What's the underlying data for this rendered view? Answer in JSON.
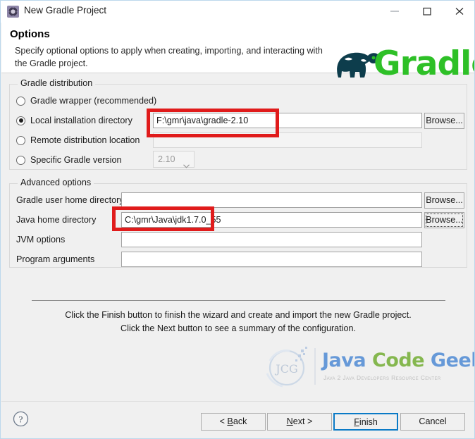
{
  "window": {
    "title": "New Gradle Project",
    "icon": "gradle-app-icon",
    "controls": {
      "minimize": "minimize-icon",
      "maximize": "maximize-icon",
      "close": "close-icon"
    }
  },
  "header": {
    "title": "Options",
    "description": "Specify optional options to apply when creating, importing, and interacting with the Gradle project.",
    "logo_text": "Gradle",
    "logo_icon": "gradle-elephant-icon",
    "logo_color": "#2ec027",
    "logo_elephant_color": "#0d3d4c"
  },
  "gradle_distribution": {
    "group_title": "Gradle distribution",
    "options": [
      {
        "label": "Gradle wrapper (recommended)",
        "selected": false
      },
      {
        "label": "Local installation directory",
        "selected": true
      },
      {
        "label": "Remote distribution location",
        "selected": false
      },
      {
        "label": "Specific Gradle version",
        "selected": false
      }
    ],
    "local_installation": {
      "value": "F:\\gmr\\java\\gradle-2.10",
      "placeholder": "",
      "enabled": true,
      "browse_label": "Browse..."
    },
    "remote_location": {
      "value": "",
      "placeholder": "",
      "enabled": false
    },
    "version_combo": {
      "value": "2.10",
      "enabled": false,
      "arrow_icon": "chevron-down-icon"
    }
  },
  "advanced_options": {
    "group_title": "Advanced options",
    "rows": [
      {
        "label": "Gradle user home directory",
        "value": "",
        "browse": "Browse...",
        "browse_focused": false
      },
      {
        "label": "Java home directory",
        "value": "C:\\gmr\\Java\\jdk1.7.0_55",
        "browse": "Browse...",
        "browse_focused": true
      },
      {
        "label": "JVM options",
        "value": "",
        "browse": null,
        "browse_focused": false
      },
      {
        "label": "Program arguments",
        "value": "",
        "browse": null,
        "browse_focused": false
      }
    ]
  },
  "annotations": {
    "highlight_color": "#e01b1b",
    "boxes": [
      {
        "name": "local-installation-directory-highlight"
      },
      {
        "name": "java-home-directory-highlight"
      }
    ]
  },
  "footer_note": {
    "line1": "Click the Finish button to finish the wizard and create and import the new",
    "line2": "Gradle project. Click the Next button to see a summary of the configuration."
  },
  "watermark": {
    "word1": "Java",
    "word2": "Code",
    "word3": "Geeks",
    "tagline": "Java 2 Java Developers Resource Center",
    "monogram": "JCG"
  },
  "bottom_bar": {
    "help_icon": "help-question-icon",
    "buttons": [
      {
        "name": "back-button",
        "prefix": "< ",
        "mnemonic": "B",
        "suffix": "ack",
        "default": false
      },
      {
        "name": "next-button",
        "prefix": "",
        "mnemonic": "N",
        "suffix": "ext >",
        "default": false
      },
      {
        "name": "finish-button",
        "prefix": "",
        "mnemonic": "F",
        "suffix": "inish",
        "default": true
      },
      {
        "name": "cancel-button",
        "prefix": "Cancel",
        "mnemonic": "",
        "suffix": "",
        "default": false
      }
    ]
  }
}
